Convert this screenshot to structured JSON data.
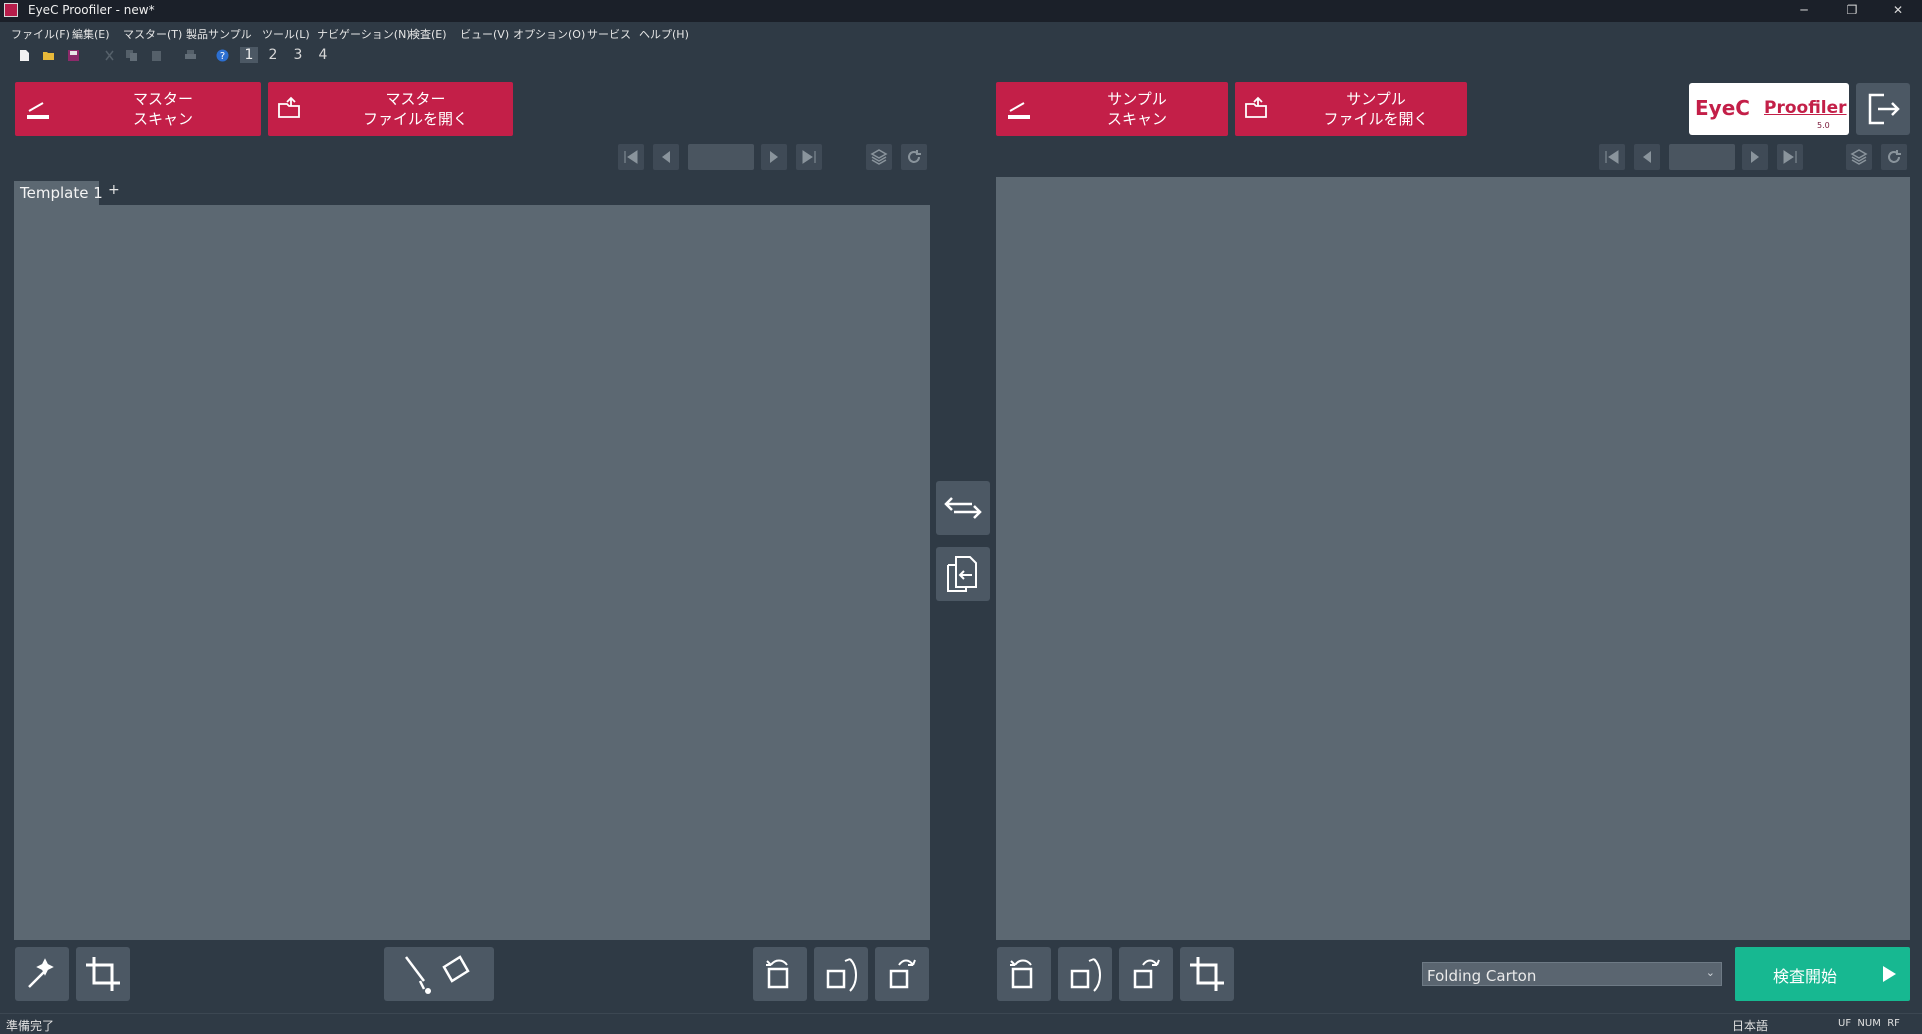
{
  "window": {
    "title": "EyeC Proofiler - new*",
    "controls": {
      "minimize": "─",
      "restore": "❐",
      "close": "✕"
    }
  },
  "menu": {
    "items": [
      "ファイル(F)",
      "編集(E)",
      "マスター(T)",
      "製品サンプル",
      "ツール(L)",
      "ナビゲーション(N)",
      "検査(E)",
      "ビュー(V)",
      "オプション(O)",
      "サービス",
      "ヘルプ(H)"
    ]
  },
  "toolbar": {
    "pages": [
      "1",
      "2",
      "3",
      "4"
    ]
  },
  "master": {
    "scan_label": "マスター\nスキャン",
    "open_label": "マスター\nファイルを開く",
    "tab_label": "Template 1",
    "tab_add": "+"
  },
  "sample": {
    "scan_label": "サンプル\nスキャン",
    "open_label": "サンプル\nファイルを開く"
  },
  "logo": {
    "brand": "EyeC",
    "product": "Proofiler",
    "version": "5.0"
  },
  "inspection": {
    "profile_value": "Folding Carton",
    "start_label": "検査開始"
  },
  "status": {
    "message": "準備完了",
    "language": "日本語",
    "indicators": "UF  NUM  RF"
  },
  "colors": {
    "accent_red": "#c31f48",
    "start_green": "#17b891",
    "background": "#2f3a45",
    "pane": "#5c6872"
  }
}
